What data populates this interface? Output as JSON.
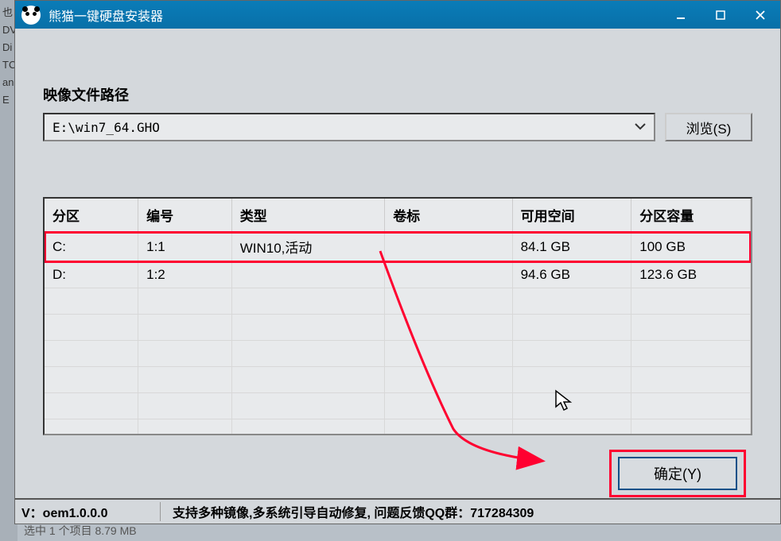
{
  "window": {
    "title": "熊猫一键硬盘安装器"
  },
  "image_path": {
    "label": "映像文件路径",
    "value": "E:\\win7_64.GHO",
    "browse_label": "浏览(S)"
  },
  "table": {
    "headers": {
      "partition": "分区",
      "number": "编号",
      "type": "类型",
      "label": "卷标",
      "free_space": "可用空间",
      "capacity": "分区容量"
    },
    "rows": [
      {
        "partition": "C:",
        "number": "1:1",
        "type": "WIN10,活动",
        "label": "",
        "free_space": "84.1 GB",
        "capacity": "100 GB",
        "highlighted": true
      },
      {
        "partition": "D:",
        "number": "1:2",
        "type": "",
        "label": "",
        "free_space": "94.6 GB",
        "capacity": "123.6 GB",
        "highlighted": false
      }
    ]
  },
  "actions": {
    "ok_label": "确定(Y)"
  },
  "statusbar": {
    "version": "V：oem1.0.0.0",
    "support": "支持多种镜像,多系统引导自动修复, 问题反馈QQ群：717284309"
  },
  "bg_text": "选中 1 个项目  8.79 MB",
  "colors": {
    "titlebar": "#0a7cb8",
    "highlight": "#ff0030",
    "button_border": "#0a5088"
  }
}
